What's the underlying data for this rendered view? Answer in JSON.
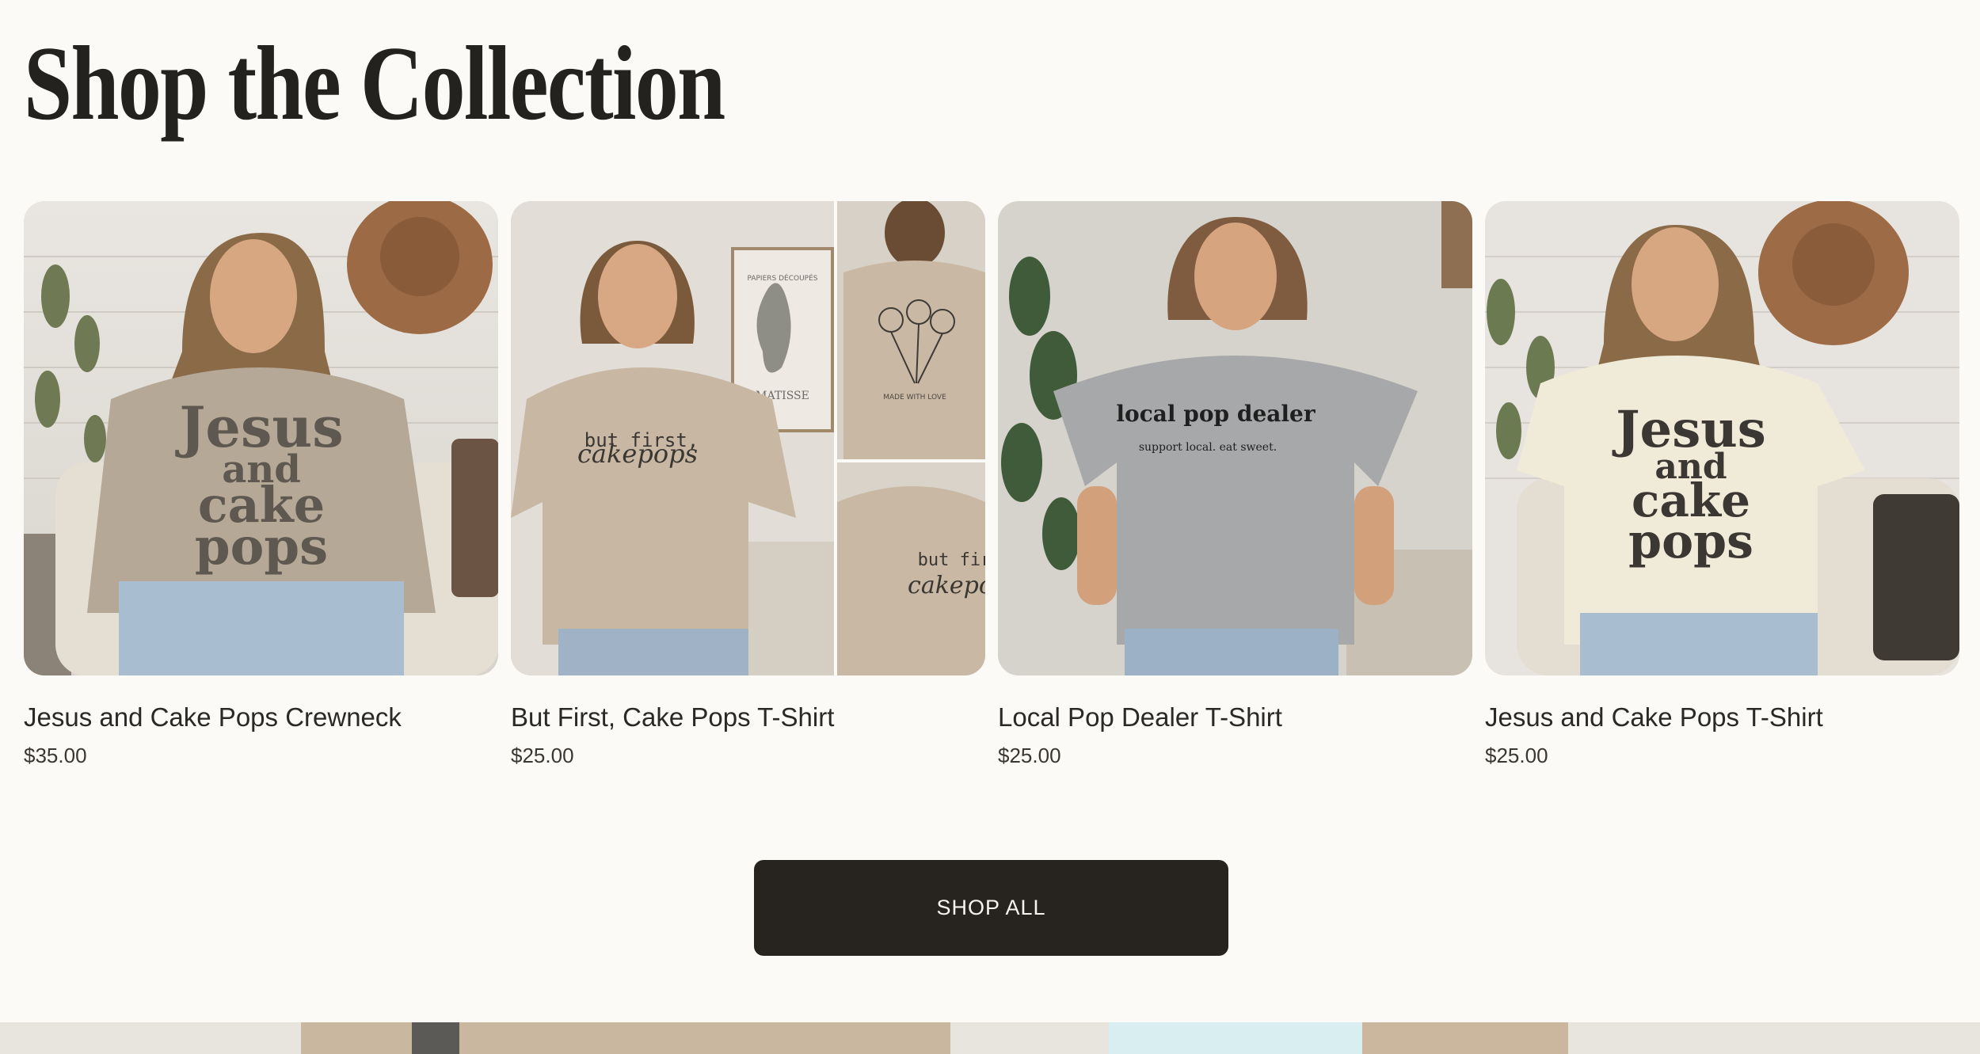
{
  "section": {
    "title": "Shop the Collection"
  },
  "products": [
    {
      "name": "Jesus and Cake Pops Crewneck",
      "price": "$35.00",
      "image_icon": "crewneck-photo",
      "print_text": [
        "Jesus",
        "and",
        "cake",
        "pops"
      ]
    },
    {
      "name": "But First, Cake Pops T-Shirt",
      "price": "$25.00",
      "image_icon": "tshirt-collage-photo",
      "print_text": [
        "but first,",
        "cakepops"
      ],
      "poster_text": [
        "PAPIERS DÉCOUPÉS",
        "MATISSE"
      ],
      "back_text": "MADE WITH LOVE",
      "inset_text": [
        "but fir",
        "cakepo"
      ]
    },
    {
      "name": "Local Pop Dealer T-Shirt",
      "price": "$25.00",
      "image_icon": "tshirt-photo",
      "print_text": [
        "local pop dealer",
        "support local. eat sweet."
      ]
    },
    {
      "name": "Jesus and Cake Pops T-Shirt",
      "price": "$25.00",
      "image_icon": "tshirt-photo",
      "print_text": [
        "Jesus",
        "and",
        "cake",
        "pops"
      ]
    }
  ],
  "cta": {
    "label": "SHOP ALL"
  },
  "colors": {
    "background": "#fcfaf6",
    "button": "#27241f",
    "button_text": "#f7f4ee",
    "title": "#24221f"
  }
}
